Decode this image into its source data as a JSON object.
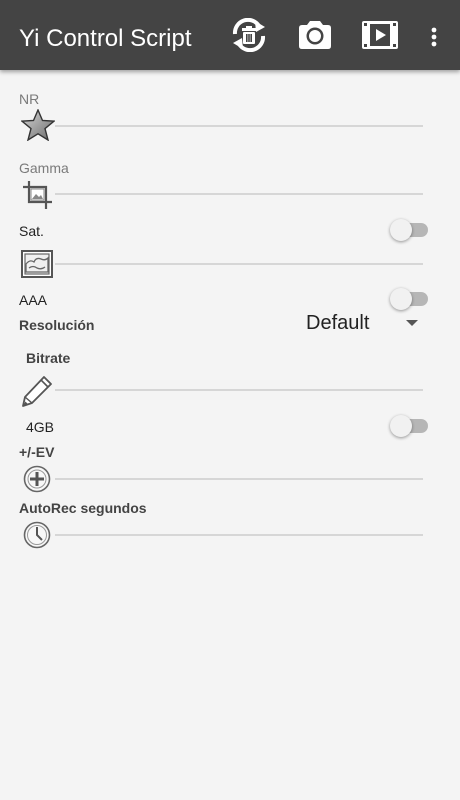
{
  "app": {
    "title": "Yi Control Script",
    "actions": {
      "sync_delete_icon": "sync-trash-icon",
      "photo_icon": "camera-icon",
      "video_icon": "video-icon",
      "overflow_icon": "more-vertical-icon"
    },
    "colors": {
      "appbar": "#444444",
      "background": "#f4f4f4"
    }
  },
  "settings": {
    "nr": {
      "label": "NR",
      "icon": "star-icon"
    },
    "gamma": {
      "label": "Gamma",
      "icon": "crop-icon"
    },
    "sat": {
      "label": "Sat.",
      "icon": "landscape-image-icon",
      "toggle_on": false
    },
    "aaa": {
      "label": "AAA",
      "toggle_on": false
    },
    "resolution": {
      "label": "Resolución",
      "value": "Default"
    },
    "bitrate": {
      "label": "Bitrate",
      "icon": "pencil-icon"
    },
    "storage": {
      "label": "4GB",
      "toggle_on": false
    },
    "ev": {
      "label": "+/-EV",
      "icon": "plus-circle-icon"
    },
    "autorec": {
      "label": "AutoRec segundos",
      "icon": "clock-icon"
    }
  }
}
